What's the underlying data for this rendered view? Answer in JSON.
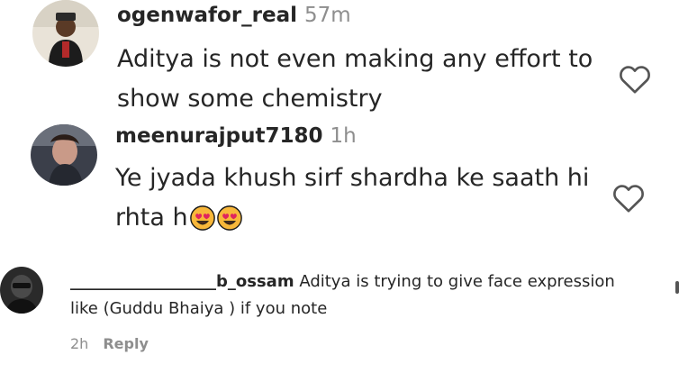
{
  "comments": [
    {
      "username": "ogenwafor_real",
      "time": "57m",
      "text": "Aditya is not even making any effort to show some chemistry"
    },
    {
      "username": "meenurajput7180",
      "time": "1h",
      "text": "Ye jyada khush sirf shardha ke saath hi rhta h"
    }
  ],
  "reply": {
    "username": "__________________b_ossam",
    "text": "Aditya is trying to give face expression like (Guddu Bhaiya ) if you note",
    "time": "2h",
    "reply_label": "Reply"
  },
  "icons": {
    "like": "heart-outline-icon",
    "emoji": "heart-eyes-emoji"
  },
  "colors": {
    "text": "#262626",
    "muted": "#8e8e8e",
    "emoji_face": "#f8b73a",
    "emoji_heart": "#e0245e"
  }
}
